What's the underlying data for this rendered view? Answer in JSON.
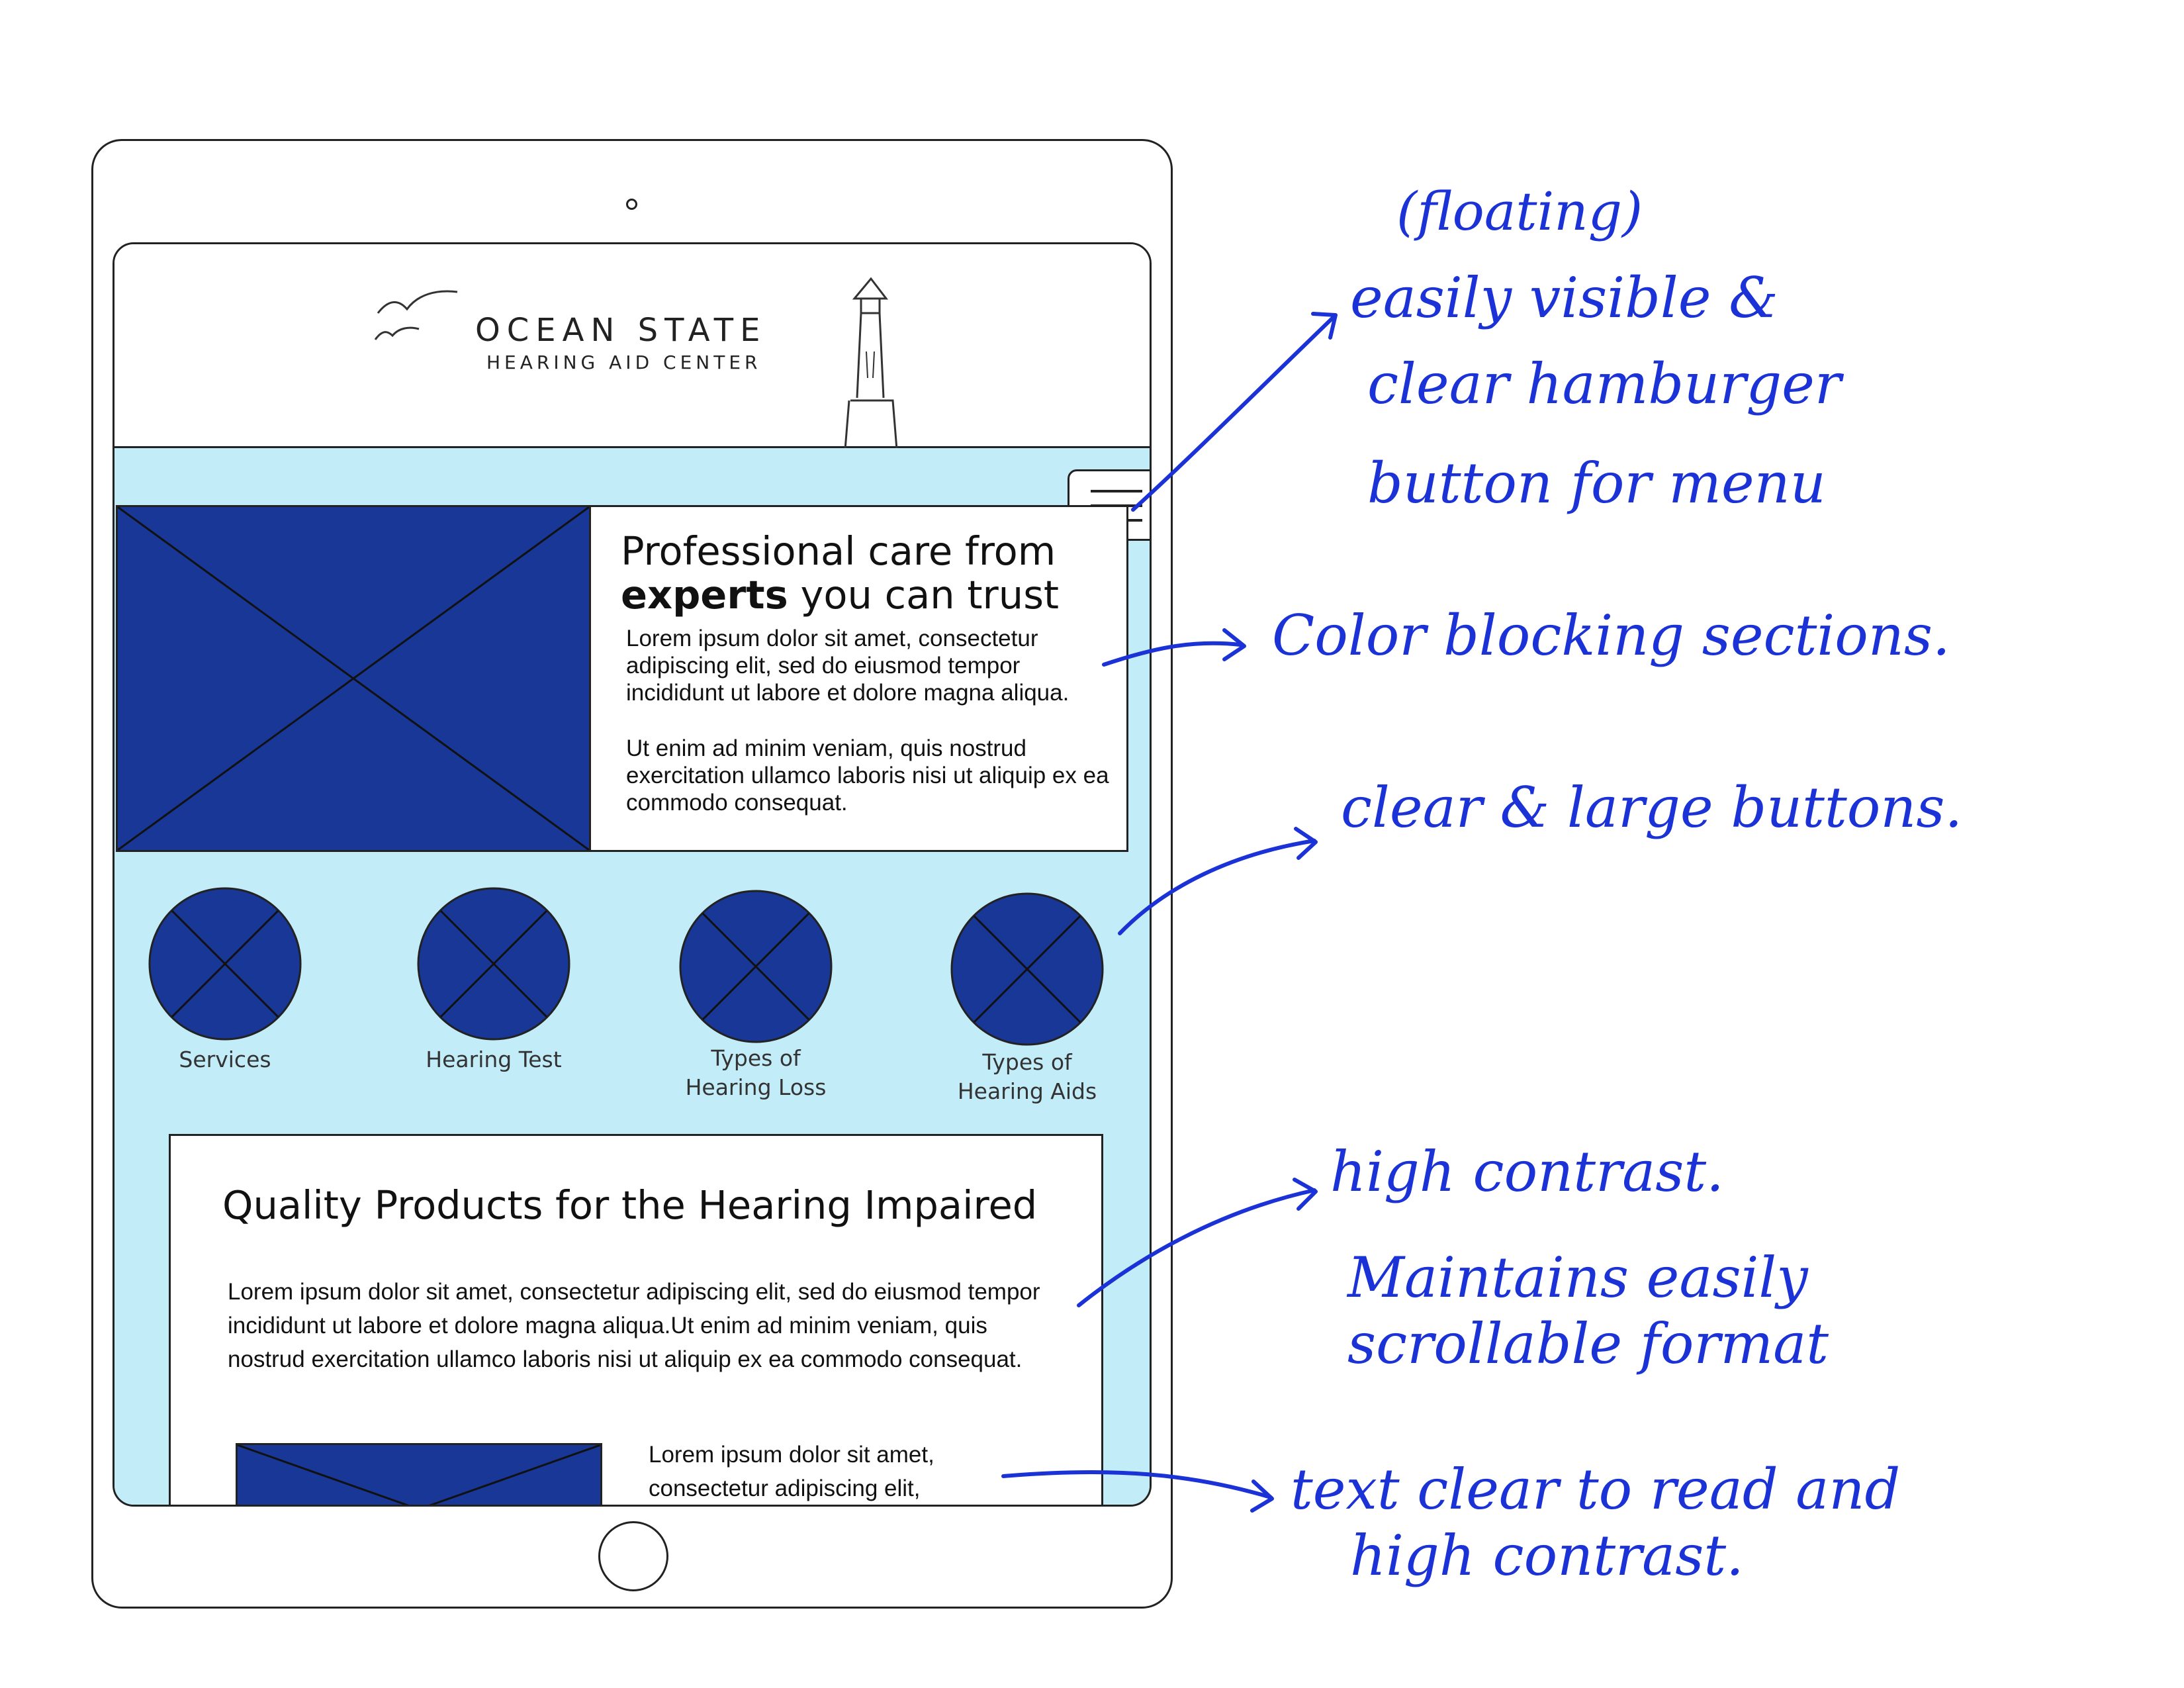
{
  "site": {
    "logo_title": "OCEAN STATE",
    "logo_subtitle": "HEARING AID CENTER",
    "hero": {
      "title_line1": "Professional care from",
      "title_bold": "experts",
      "title_rest": " you can trust",
      "paragraph1": "Lorem ipsum dolor sit amet, consectetur adipiscing elit, sed do eiusmod tempor incididunt ut labore et dolore magna aliqua.",
      "paragraph2": "Ut enim ad minim veniam, quis nostrud exercitation ullamco laboris nisi ut aliquip ex ea commodo consequat."
    },
    "nav_buttons": [
      {
        "label": "Services"
      },
      {
        "label": "Hearing Test"
      },
      {
        "label_line1": "Types of",
        "label_line2": "Hearing Loss"
      },
      {
        "label_line1": "Types of",
        "label_line2": "Hearing Aids"
      }
    ],
    "products": {
      "title": "Quality Products for the Hearing Impaired",
      "paragraph": "Lorem ipsum dolor sit amet, consectetur adipiscing elit, sed do eiusmod tempor incididunt ut labore et dolore magna aliqua.Ut enim ad minim veniam, quis nostrud exercitation ullamco laboris nisi ut aliquip ex ea commodo consequat.",
      "paragraph2": "Lorem ipsum dolor sit amet, consectetur adipiscing elit,"
    }
  },
  "annotations": {
    "hamburger": [
      "(floating)",
      "easily visible &",
      "clear hamburger",
      "button for menu"
    ],
    "color_blocking": "Color blocking sections.",
    "buttons": "clear & large buttons.",
    "contrast": [
      "high contrast.",
      "Maintains easily",
      "scrollable format"
    ],
    "text": [
      "text clear to read and",
      "high contrast."
    ]
  },
  "colors": {
    "navy": "#183796",
    "light_blue": "#c2ecf8",
    "annotation_ink": "#1a32d6",
    "outline": "#222222"
  },
  "icons": [
    "gulls-icon",
    "lighthouse-icon",
    "hamburger-icon",
    "image-placeholder-icon"
  ]
}
